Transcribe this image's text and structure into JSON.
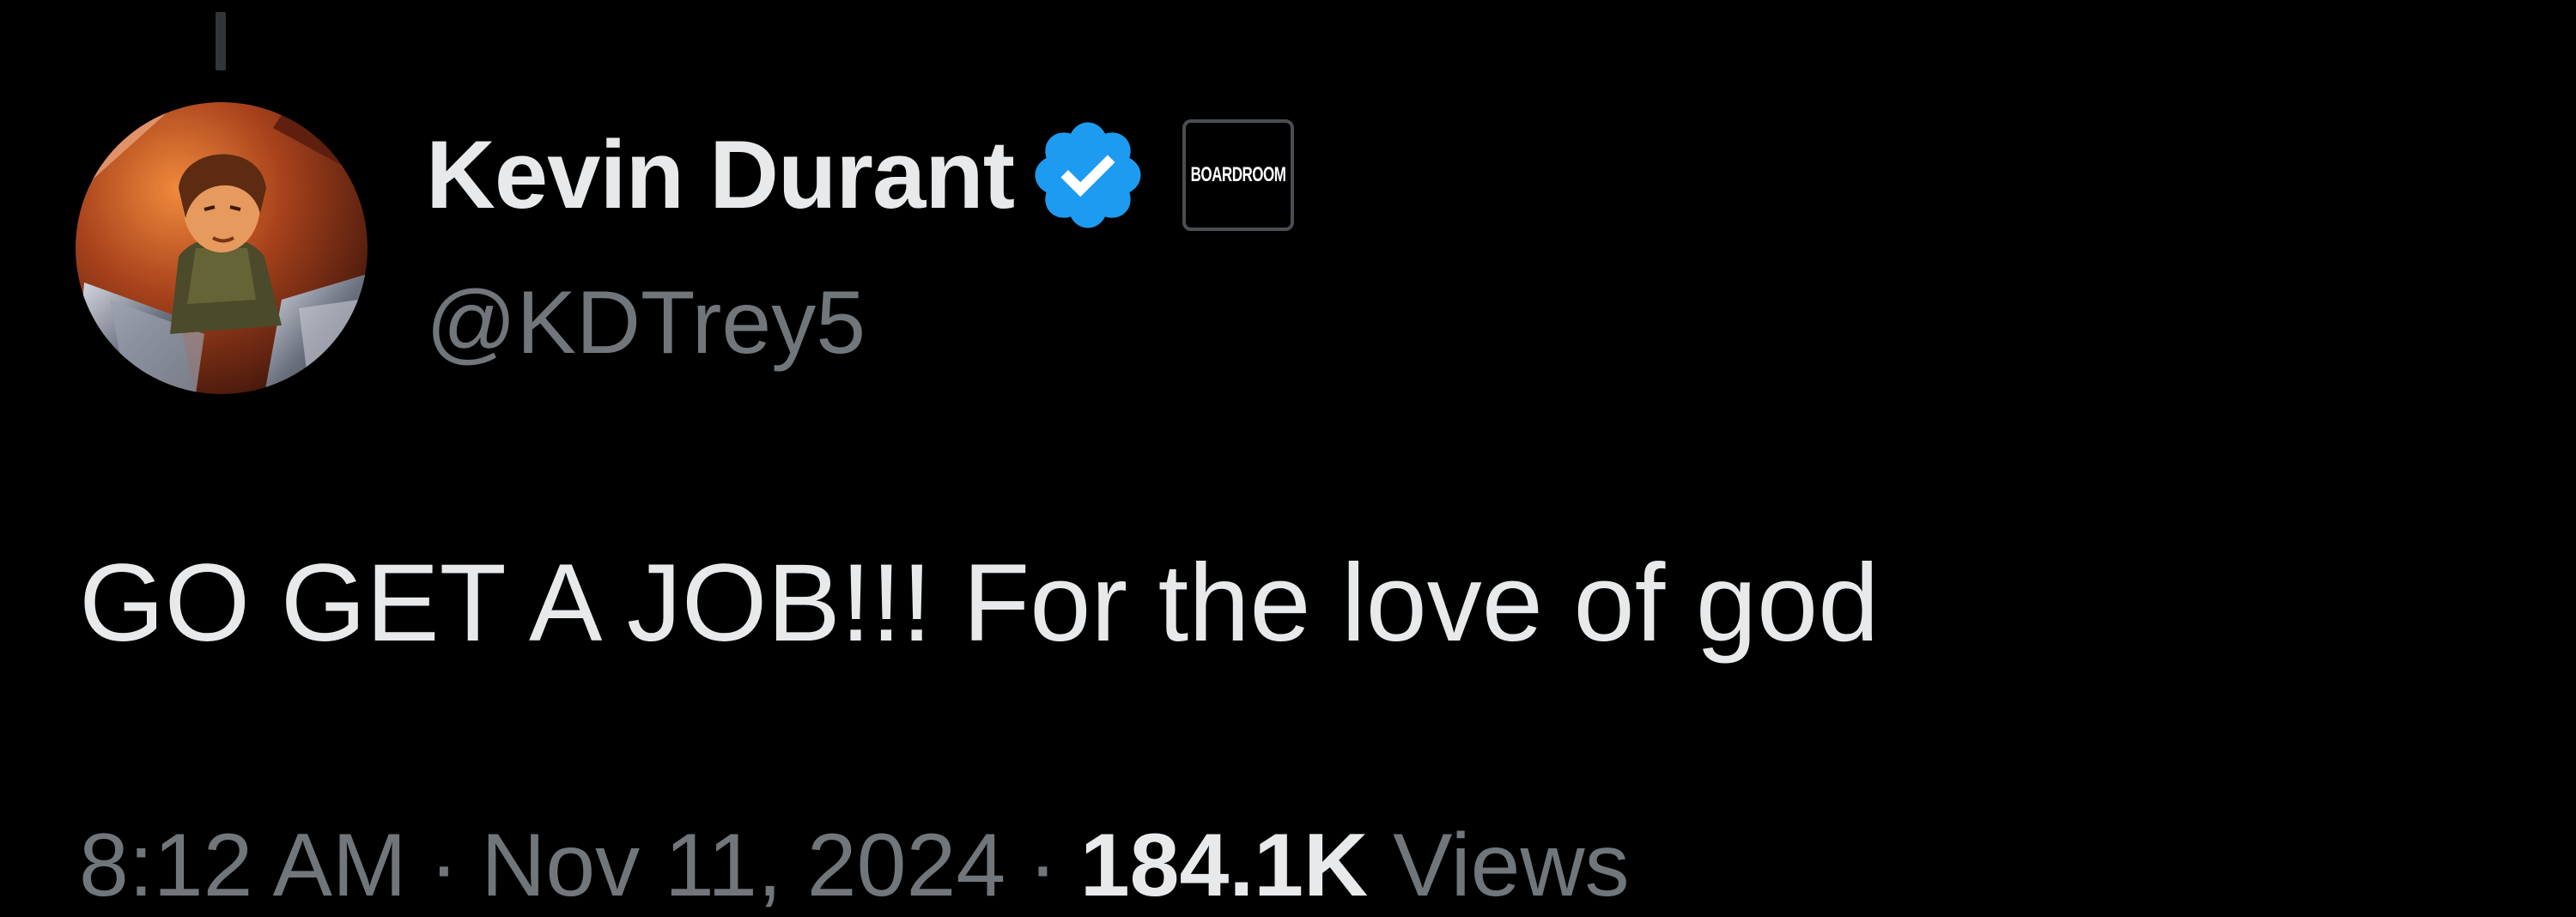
{
  "colors": {
    "background": "#000000",
    "primary_text": "#e7e9ea",
    "secondary_text": "#71767b",
    "verified_badge": "#1d9bf0"
  },
  "tweet": {
    "author": {
      "display_name": "Kevin Durant",
      "handle": "@KDTrey5",
      "verified_icon": "verified-badge-icon",
      "affiliate_badge": {
        "label": "BOARDROOM"
      }
    },
    "text": "GO GET A JOB!!! For the love of god",
    "meta": {
      "time": "8:12 AM",
      "separator": "·",
      "date": "Nov 11, 2024",
      "views_count": "184.1K",
      "views_label": "Views"
    }
  }
}
